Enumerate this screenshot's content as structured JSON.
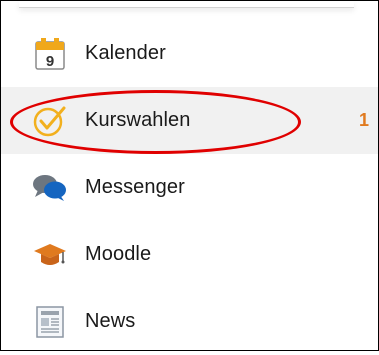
{
  "menu": {
    "items": [
      {
        "label": "Kalender",
        "icon": "calendar-icon",
        "calendar_day": "9"
      },
      {
        "label": "Kurswahlen",
        "icon": "checkmark-icon",
        "badge": "1",
        "active": true
      },
      {
        "label": "Messenger",
        "icon": "chat-bubbles-icon"
      },
      {
        "label": "Moodle",
        "icon": "graduation-cap-icon"
      },
      {
        "label": "News",
        "icon": "newspaper-icon"
      }
    ]
  },
  "colors": {
    "badge": "#e07a1f",
    "highlight_ellipse": "#e00000",
    "active_background": "#f1f1f1",
    "calendar_accent": "#f0a81b",
    "check_accent": "#f2b01e",
    "messenger_blue": "#1565c0",
    "messenger_gray": "#6d7680",
    "moodle_orange": "#e07a1f"
  }
}
